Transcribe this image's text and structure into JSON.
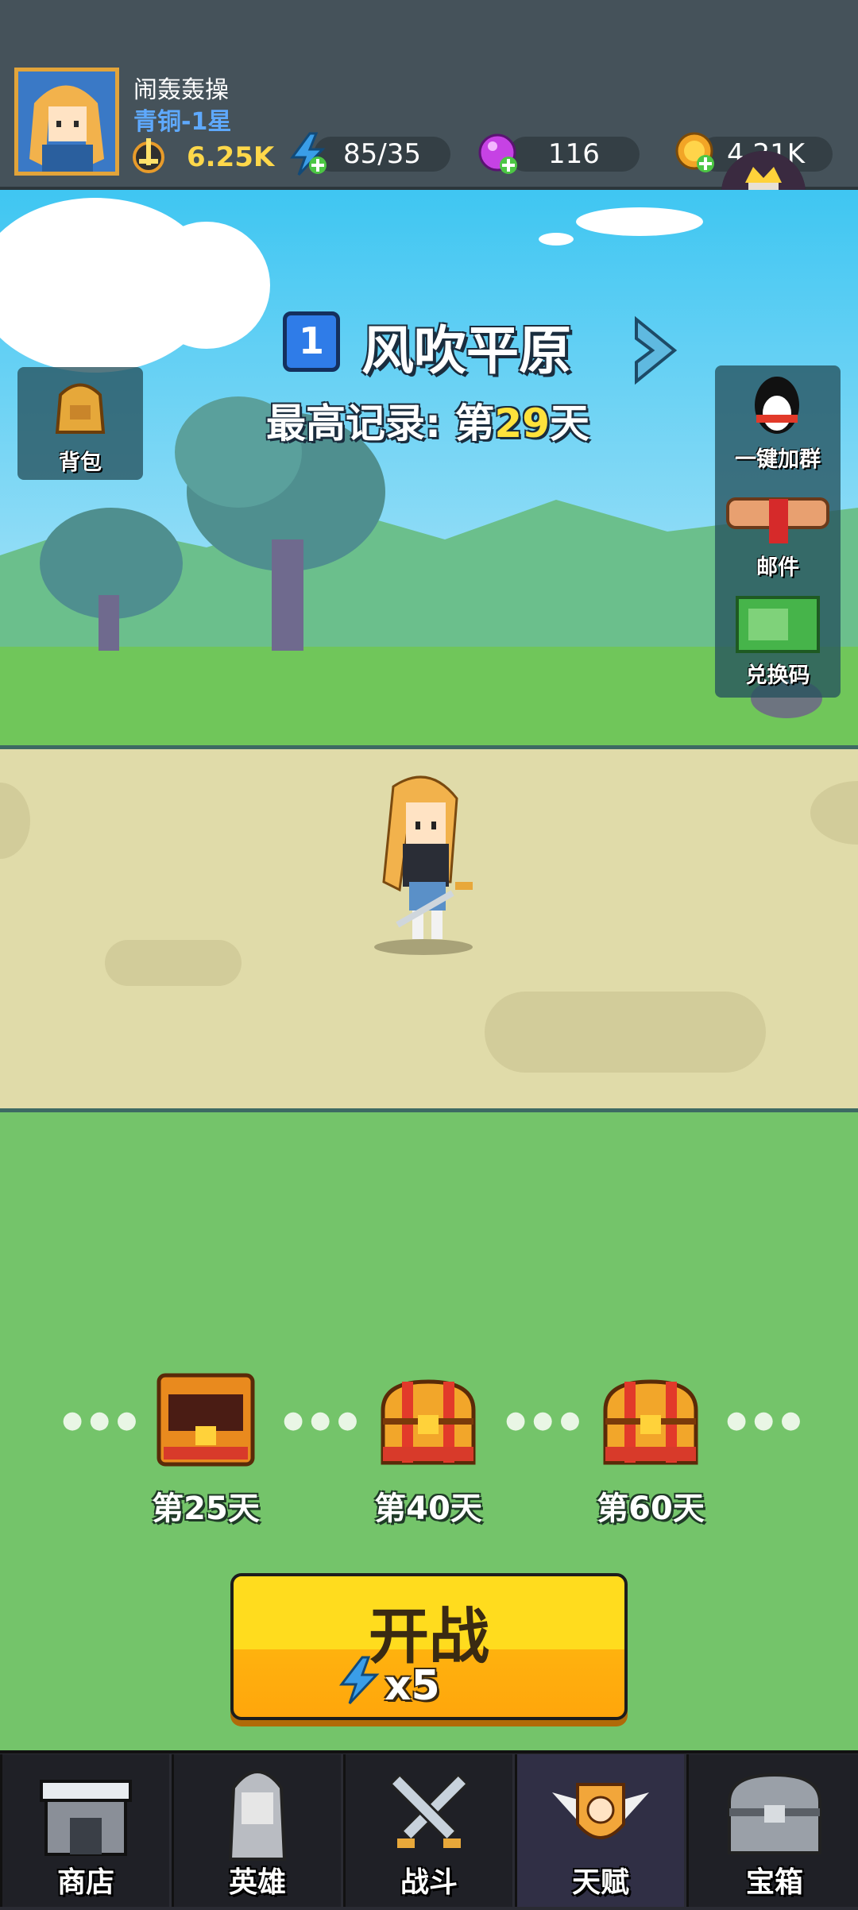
{
  "player": {
    "name": "闹轰轰操",
    "rank": "青铜-1星",
    "power": "6.25K"
  },
  "resources": {
    "energy": "85/35",
    "gems": "116",
    "gold": "4.21K"
  },
  "side_left": {
    "backpack": "背包"
  },
  "side_right": {
    "group": "一键加群",
    "mail": "邮件",
    "redeem": "兑换码"
  },
  "stage": {
    "number": "1",
    "name": "风吹平原",
    "record_prefix": "最高记录: 第",
    "record_day": "29",
    "record_suffix": "天"
  },
  "chests": [
    {
      "label": "第25天",
      "state": "opened"
    },
    {
      "label": "第40天",
      "state": "closed"
    },
    {
      "label": "第60天",
      "state": "closed"
    }
  ],
  "start": {
    "title": "开战",
    "cost": "x5"
  },
  "nav": [
    {
      "label": "商店"
    },
    {
      "label": "英雄"
    },
    {
      "label": "战斗"
    },
    {
      "label": "天赋"
    },
    {
      "label": "宝箱"
    }
  ],
  "colors": {
    "accent_button": "#ffdc1e",
    "grass": "#74c46a",
    "sky": "#3fc6f2"
  }
}
